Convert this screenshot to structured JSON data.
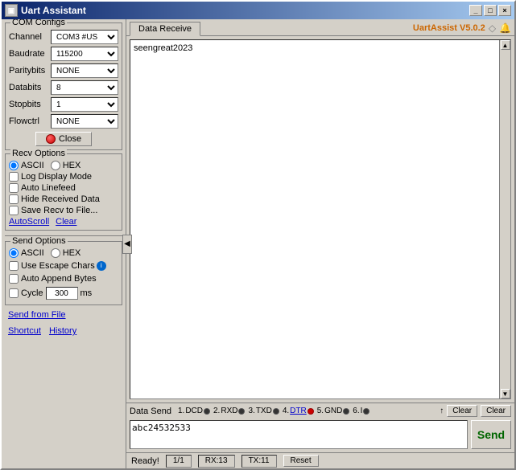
{
  "window": {
    "title": "Uart Assistant",
    "titlebar_icon": "U"
  },
  "com_configs": {
    "group_title": "COM Configs",
    "channel_label": "Channel",
    "channel_value": "COM3 #US",
    "baudrate_label": "Baudrate",
    "baudrate_value": "115200",
    "paritybits_label": "Paritybits",
    "paritybits_value": "NONE",
    "databits_label": "Databits",
    "databits_value": "8",
    "stopbits_label": "Stopbits",
    "stopbits_value": "1",
    "flowctrl_label": "Flowctrl",
    "flowctrl_value": "NONE",
    "close_btn_label": "Close"
  },
  "recv_options": {
    "group_title": "Recv Options",
    "ascii_label": "ASCII",
    "hex_label": "HEX",
    "log_display_label": "Log Display Mode",
    "auto_linefeed_label": "Auto Linefeed",
    "hide_received_label": "Hide Received Data",
    "save_recv_label": "Save Recv to File...",
    "autoscroll_link": "AutoScroll",
    "clear_link": "Clear"
  },
  "send_options": {
    "group_title": "Send Options",
    "ascii_label": "ASCII",
    "hex_label": "HEX",
    "use_escape_label": "Use Escape Chars",
    "auto_append_label": "Auto Append Bytes",
    "cycle_label": "Cycle",
    "cycle_value": "300",
    "ms_label": "ms"
  },
  "send_from_file": {
    "label": "Send from File"
  },
  "shortcut": {
    "label": "Shortcut",
    "history_label": "History"
  },
  "data_receive": {
    "tab_label": "Data Receive",
    "version_label": "UartAssist V5.0.2",
    "content": "seengreat2023"
  },
  "data_send": {
    "label": "Data Send",
    "signals": [
      {
        "num": "1.",
        "name": "DCD",
        "state": "off"
      },
      {
        "num": "2.",
        "name": "RXD",
        "state": "off"
      },
      {
        "num": "3.",
        "name": "TXD",
        "state": "off"
      },
      {
        "num": "4.",
        "name": "DTR",
        "state": "on_red",
        "underline": true
      },
      {
        "num": "5.",
        "name": "GND",
        "state": "off"
      },
      {
        "num": "6.",
        "name": "I",
        "state": "off"
      }
    ],
    "clear1_label": "Clear",
    "arrow_label": "↑",
    "clear2_label": "Clear",
    "send_content": "abc24532533",
    "send_btn_label": "Send"
  },
  "status_bar": {
    "ready_text": "Ready!",
    "page_info": "1/1",
    "rx_label": "RX:13",
    "tx_label": "TX:11",
    "reset_label": "Reset"
  }
}
